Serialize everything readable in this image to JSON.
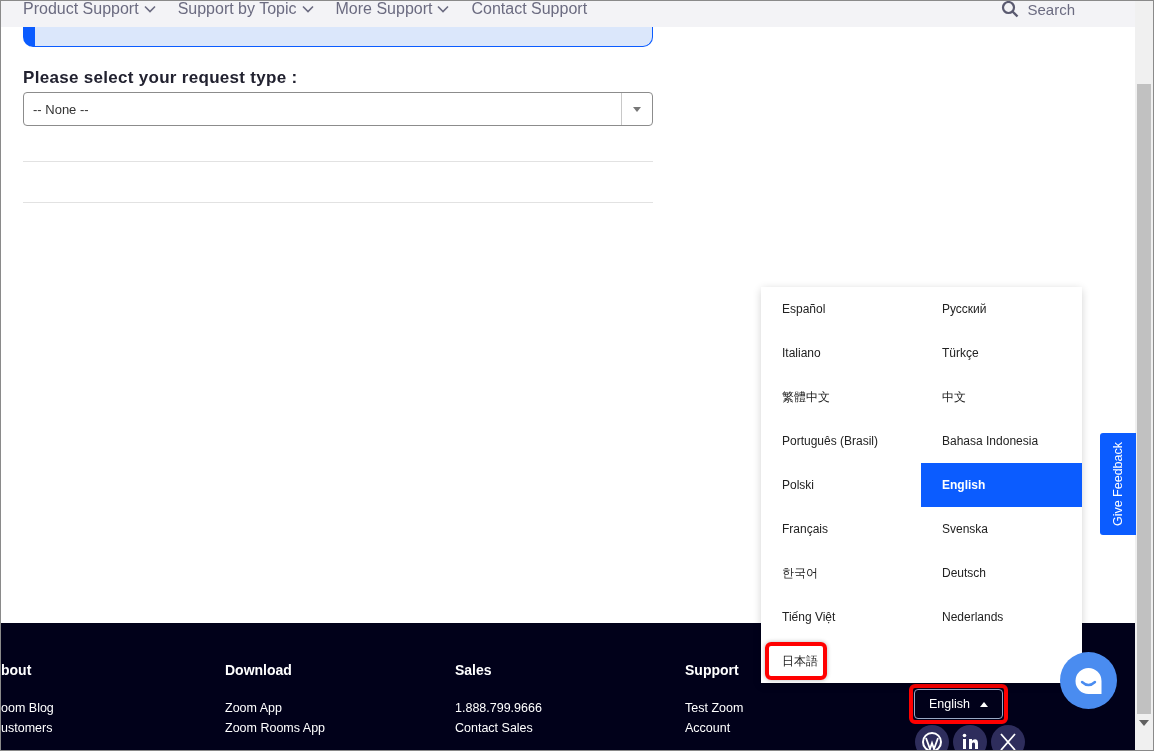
{
  "nav": {
    "items": [
      {
        "label": "Product Support",
        "has_menu": true
      },
      {
        "label": "Support by Topic",
        "has_menu": true
      },
      {
        "label": "More Support",
        "has_menu": true
      },
      {
        "label": "Contact Support",
        "has_menu": false
      }
    ],
    "search": {
      "label": "Search"
    }
  },
  "form": {
    "label": "Please select your request type :",
    "select": {
      "value": "-- None --"
    }
  },
  "language_menu": {
    "items": [
      {
        "label": "Español",
        "selected": false,
        "highlighted": false
      },
      {
        "label": "Русский",
        "selected": false,
        "highlighted": false
      },
      {
        "label": "Italiano",
        "selected": false,
        "highlighted": false
      },
      {
        "label": "Türkçe",
        "selected": false,
        "highlighted": false
      },
      {
        "label": "繁體中文",
        "selected": false,
        "highlighted": false
      },
      {
        "label": "中文",
        "selected": false,
        "highlighted": false
      },
      {
        "label": "Português (Brasil)",
        "selected": false,
        "highlighted": false
      },
      {
        "label": "Bahasa Indonesia",
        "selected": false,
        "highlighted": false
      },
      {
        "label": "Polski",
        "selected": false,
        "highlighted": false
      },
      {
        "label": "English",
        "selected": true,
        "highlighted": false
      },
      {
        "label": "Français",
        "selected": false,
        "highlighted": false
      },
      {
        "label": "Svenska",
        "selected": false,
        "highlighted": false
      },
      {
        "label": "한국어",
        "selected": false,
        "highlighted": false
      },
      {
        "label": "Deutsch",
        "selected": false,
        "highlighted": false
      },
      {
        "label": "Tiếng Việt",
        "selected": false,
        "highlighted": false
      },
      {
        "label": "Nederlands",
        "selected": false,
        "highlighted": false
      },
      {
        "label": "日本語",
        "selected": false,
        "highlighted": true
      }
    ]
  },
  "feedback_tab": {
    "label": "Give Feedback"
  },
  "footer": {
    "columns": [
      {
        "heading": "bout",
        "links": [
          "oom Blog",
          "ustomers"
        ]
      },
      {
        "heading": "Download",
        "links": [
          "Zoom App",
          "Zoom Rooms App"
        ]
      },
      {
        "heading": "Sales",
        "links": [
          "1.888.799.9666",
          "Contact Sales"
        ]
      },
      {
        "heading": "Support",
        "links": [
          "Test Zoom",
          "Account"
        ]
      }
    ],
    "language_button": {
      "label": "English",
      "highlighted": true
    }
  }
}
